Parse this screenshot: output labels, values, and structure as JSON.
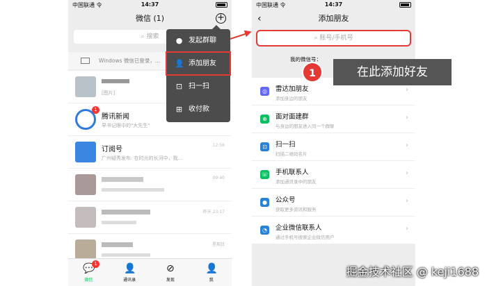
{
  "left": {
    "status": {
      "carrier": "中国联通 令",
      "time": "14:37"
    },
    "title": "微信 (1)",
    "search_placeholder": "搜索",
    "windows_banner": "Windows 微信已登录，...",
    "chats": [
      {
        "name": "",
        "sub": "[图片]",
        "time": ""
      },
      {
        "name": "腾讯新闻",
        "sub": "早书记眼中的\"大先生\"",
        "time": ""
      },
      {
        "name": "订阅号",
        "sub": "广州疑秀发布: 在时光的长河中，我...",
        "time": "12:56"
      },
      {
        "name": "",
        "sub": "",
        "time": "09:40"
      },
      {
        "name": "",
        "sub": "",
        "time": "昨天 23:17"
      },
      {
        "name": "",
        "sub": "",
        "time": "星期日"
      }
    ],
    "menu": [
      "发起群聊",
      "添加朋友",
      "扫一扫",
      "收付款"
    ],
    "tabs": [
      "微信",
      "通讯录",
      "发现",
      "我"
    ],
    "tab_badge": "1",
    "news_badge": "1"
  },
  "right": {
    "status": {
      "carrier": "中国联通 令",
      "time": "14:37"
    },
    "title": "添加朋友",
    "search_placeholder": "账号/手机号",
    "my_wechat_label": "我的微信号：",
    "rows": [
      {
        "name": "雷达加朋友",
        "sub": "添加身边的朋友",
        "icon_color": "#6467f0"
      },
      {
        "name": "面对面建群",
        "sub": "与身边的朋友进入同一个群聊",
        "icon_color": "#07c160"
      },
      {
        "name": "扫一扫",
        "sub": "扫描二维码名片",
        "icon_color": "#2782d7"
      },
      {
        "name": "手机联系人",
        "sub": "添加通讯录中的朋友",
        "icon_color": "#07c160"
      },
      {
        "name": "公众号",
        "sub": "获取更多资讯和服务",
        "icon_color": "#2782d7"
      },
      {
        "name": "企业微信联系人",
        "sub": "通过手机号搜索企业微信用户",
        "icon_color": "#2782d7"
      }
    ]
  },
  "annotation": {
    "number": "1",
    "text": "在此添加好友"
  },
  "watermark": "掘金技术社区 @ keji1688",
  "colors": {
    "accent": "#07c160",
    "highlight": "#e53935",
    "menu_bg": "#4c4c4c"
  }
}
